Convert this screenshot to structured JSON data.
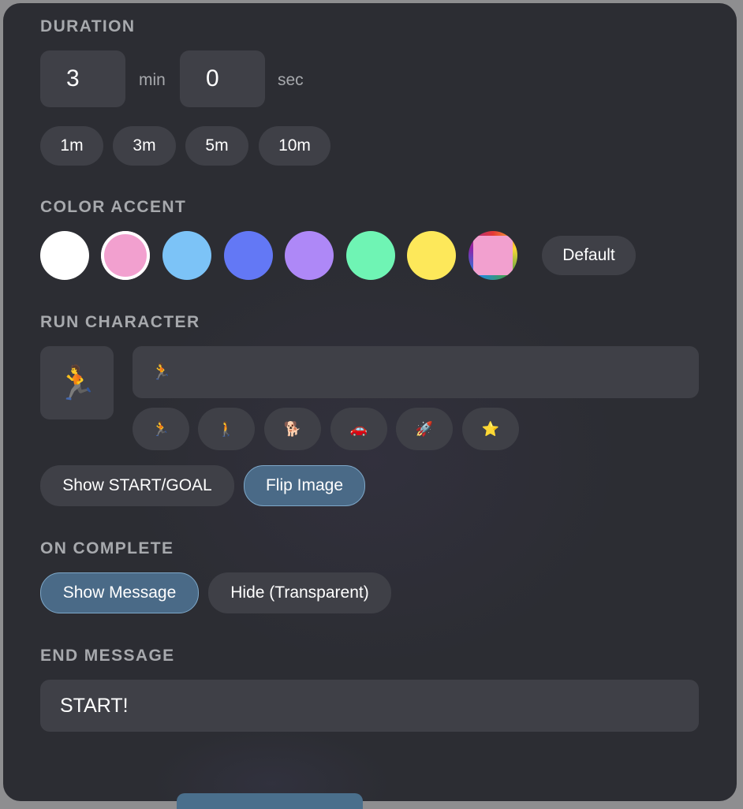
{
  "duration": {
    "title": "DURATION",
    "minutes": "3",
    "minutes_unit": "min",
    "seconds": "0",
    "seconds_unit": "sec",
    "presets": [
      "1m",
      "3m",
      "5m",
      "10m"
    ]
  },
  "color_accent": {
    "title": "COLOR ACCENT",
    "swatches": [
      {
        "name": "white",
        "color": "#ffffff",
        "selected": false
      },
      {
        "name": "pink",
        "color": "#f2a0cf",
        "selected": true
      },
      {
        "name": "light-blue",
        "color": "#7cc3f7",
        "selected": false
      },
      {
        "name": "blue",
        "color": "#6378f5",
        "selected": false
      },
      {
        "name": "purple",
        "color": "#ae88f7",
        "selected": false
      },
      {
        "name": "green",
        "color": "#6ff4b4",
        "selected": false
      },
      {
        "name": "yellow",
        "color": "#fde85a",
        "selected": false
      },
      {
        "name": "rainbow",
        "color": "rainbow",
        "selected": false
      }
    ],
    "default_label": "Default"
  },
  "run_character": {
    "title": "RUN CHARACTER",
    "preview": "🏃",
    "input_value": "🏃",
    "options": [
      "🏃",
      "🚶",
      "🐕",
      "🚗",
      "🚀",
      "⭐"
    ],
    "show_start_goal_label": "Show START/GOAL",
    "flip_image_label": "Flip Image",
    "flip_image_active": true
  },
  "on_complete": {
    "title": "ON COMPLETE",
    "show_message_label": "Show Message",
    "hide_label": "Hide (Transparent)",
    "active": "show_message"
  },
  "end_message": {
    "title": "END MESSAGE",
    "value": "START!"
  },
  "colors": {
    "panel_bg": "#2c2d33",
    "control_bg": "#3f4047",
    "active_bg": "#4a6a87",
    "active_border": "#7ea8c9",
    "label_text": "#a7a9ad"
  }
}
